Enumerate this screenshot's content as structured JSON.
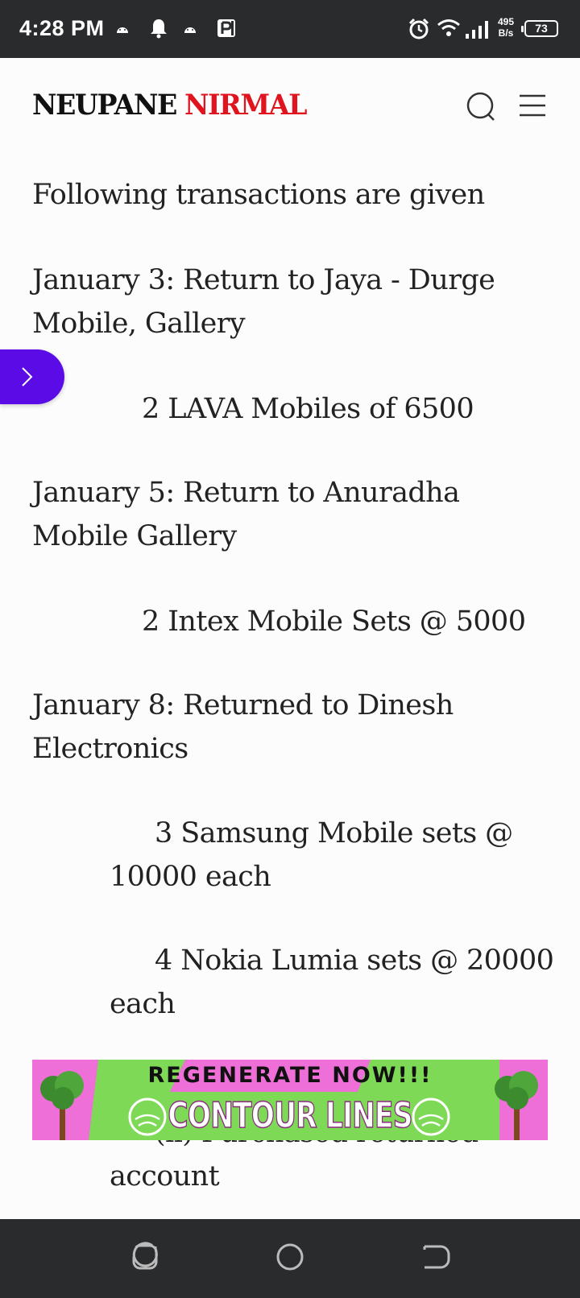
{
  "status_bar": {
    "time": "4:28 PM",
    "net_speed_value": "495",
    "net_speed_unit": "B/s",
    "battery": "73"
  },
  "header": {
    "logo_part1": "NEUPANE",
    "logo_part2": "NIRMAL",
    "search_icon": "search-icon",
    "menu_icon": "hamburger-menu-icon"
  },
  "content": {
    "paragraphs": [
      "Following transactions are given",
      "January 3: Return to Jaya - Durge Mobile, Gallery",
      "2 LAVA Mobiles of 6500",
      "January 5: Return to Anuradha Mobile Gallery",
      "2 Intex Mobile Sets @ 5000",
      "January 8: Returned to Dinesh Electronics",
      "3 Samsung Mobile sets @ 10000 each",
      "4 Nokia Lumia sets @ 20000 each",
      "(ii) Purchased returned account"
    ]
  },
  "ad": {
    "line1": "REGENERATE NOW!!!",
    "line2": "CONTOUR LINES",
    "colors": {
      "pink": "#ef6fd8",
      "green": "#7ed957"
    }
  },
  "side_tab": {
    "icon": "chevron-right-icon",
    "color": "#5b0ce6"
  },
  "nav_bar": {
    "recents": "recents-icon",
    "home": "home-icon",
    "back": "back-icon"
  }
}
